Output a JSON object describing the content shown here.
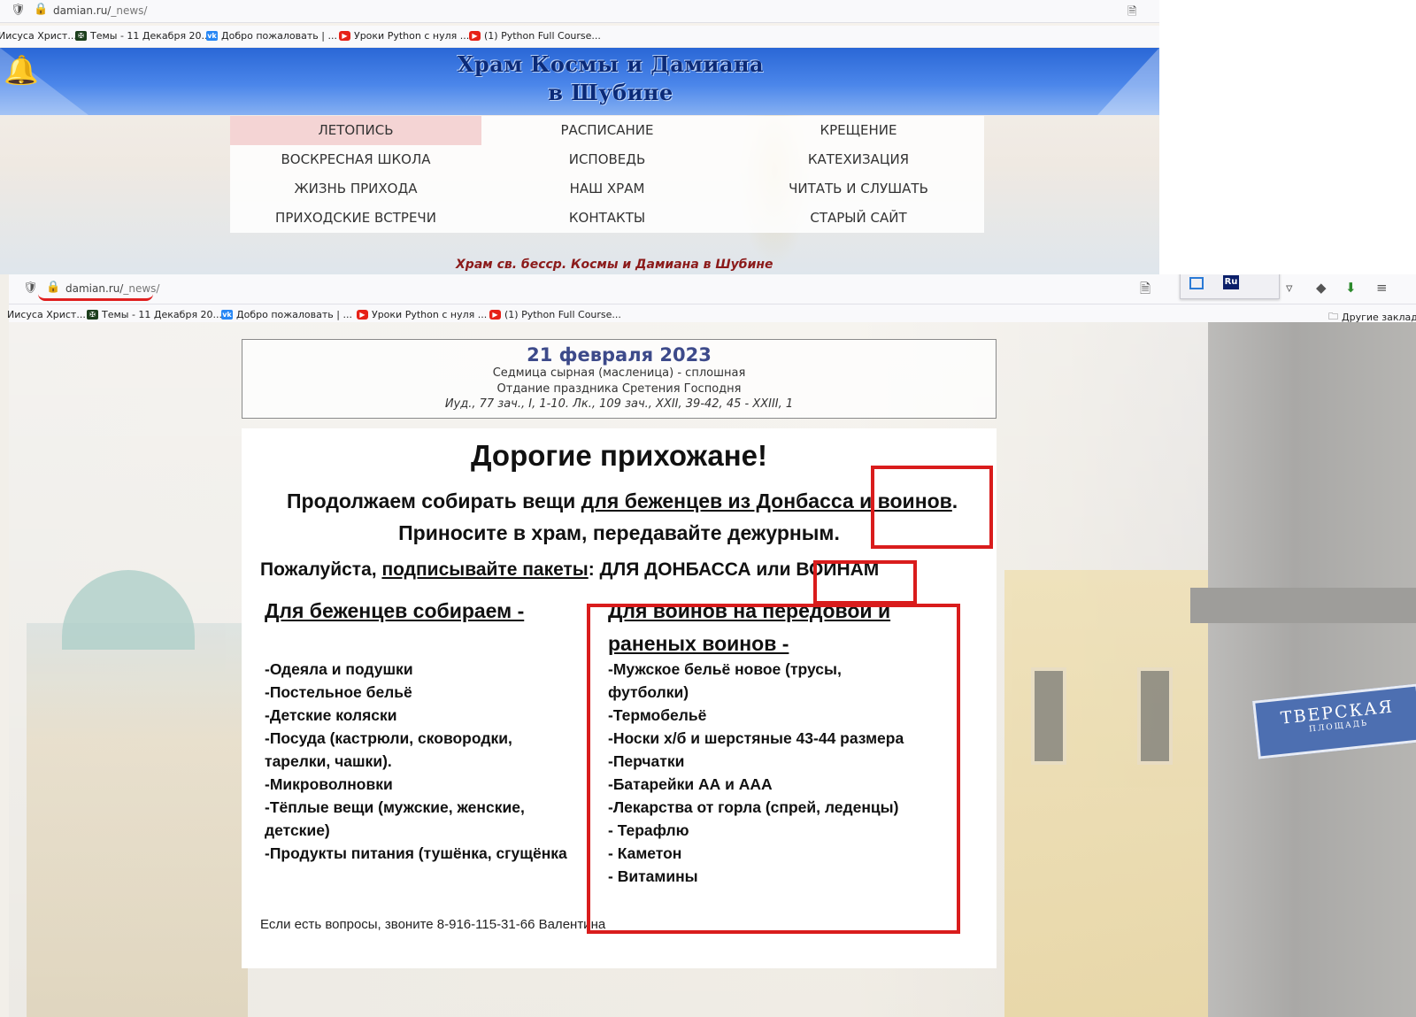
{
  "top_window": {
    "url": "damian.ru/",
    "url_path": "_news/",
    "bookmarks": [
      {
        "label": "Иисуса Христ...",
        "icon": "none"
      },
      {
        "label": "Темы - 11 Декабря 20...",
        "icon": "cross"
      },
      {
        "label": "Добро пожаловать | ...",
        "icon": "vk"
      },
      {
        "label": "Уроки Python с нуля ...",
        "icon": "youtube"
      },
      {
        "label": "(1) Python Full Course...",
        "icon": "youtube"
      }
    ],
    "banner_title_line1": "Храм Космы и Дамиана",
    "banner_title_line2": "в Шубине",
    "menu": [
      [
        "ЛЕТОПИСЬ",
        "РАСПИСАНИЕ",
        "КРЕЩЕНИЕ"
      ],
      [
        "ВОСКРЕСНАЯ ШКОЛА",
        "ИСПОВЕДЬ",
        "КАТЕХИЗАЦИЯ"
      ],
      [
        "ЖИЗНЬ ПРИХОДА",
        "НАШ ХРАМ",
        "ЧИТАТЬ И СЛУШАТЬ"
      ],
      [
        "ПРИХОДСКИЕ ВСТРЕЧИ",
        "КОНТАКТЫ",
        "СТАРЫЙ САЙТ"
      ]
    ],
    "active_menu": "ЛЕТОПИСЬ",
    "tagline": "Храм св. бесср. Космы и Дамиана в Шубине"
  },
  "bottom_window": {
    "url": "damian.ru/",
    "url_path": "_news/",
    "bookmarks": [
      {
        "label": "Иисуса Христ...",
        "icon": "none"
      },
      {
        "label": "Темы - 11 Декабря 20...",
        "icon": "cross"
      },
      {
        "label": "Добро пожаловать | ...",
        "icon": "vk"
      },
      {
        "label": "Уроки Python с нуля ...",
        "icon": "youtube"
      },
      {
        "label": "(1) Python Full Course...",
        "icon": "youtube"
      }
    ],
    "other_bookmarks": "Другие закладки",
    "ext_label": "Ru",
    "street_sign_line1": "ТВЕРСКАЯ",
    "street_sign_line2": "ПЛОЩАДЬ",
    "date": "21 февраля 2023",
    "day_line1": "Седмица сырная (масленица) - сплошная",
    "day_line2": "Отдание праздника Сретения Господня",
    "readings": "Иуд., 77 зач., I, 1-10. Лк., 109 зач., XXII, 39-42, 45 - XXIII, 1",
    "heading": "Дорогие прихожане!",
    "line1_a": "Продолжаем собирать вещи ",
    "line1_b": "для беженцев из Донбасса и воинов",
    "line1_c": ".",
    "line2": "Приносите в храм, передавайте дежурным.",
    "line3_a": "Пожалуйста, ",
    "line3_b": "подписывайте пакеты",
    "line3_c": ": ДЛЯ ДОНБАССА или ВОИНАМ",
    "col_left_heading": "Для беженцев собираем -",
    "col_left_items": [
      "-Одеяла и подушки",
      "-Постельное бельё",
      "-Детские коляски",
      "-Посуда (кастрюли, сковородки,",
      "тарелки, чашки).",
      "-Микроволновки",
      "-Тёплые вещи (мужские, женские,",
      "детские)",
      "-Продукты питания (тушёнка, сгущёнка"
    ],
    "col_right_heading_line1": "Для воинов на передовой и",
    "col_right_heading_line2": "раненых воинов -",
    "col_right_items": [
      "-Мужское бельё новое (трусы,",
      "футболки)",
      "-Термобельё",
      "-Носки х/б и шерстяные 43-44 размера",
      "-Перчатки",
      "-Батарейки АА и ААА",
      "-Лекарства от горла (спрей, леденцы)",
      "- Терафлю",
      "- Каметон",
      "- Витамины"
    ],
    "contact": "Если есть вопросы, звоните 8-916-115-31-66 Валентина"
  },
  "colors": {
    "annotation_red": "#d91c1c",
    "banner_blue": "#2a67d6",
    "menu_active": "#f4d4d4",
    "date_blue": "#3d4a8a",
    "tagline_red": "#8b1a1a"
  }
}
